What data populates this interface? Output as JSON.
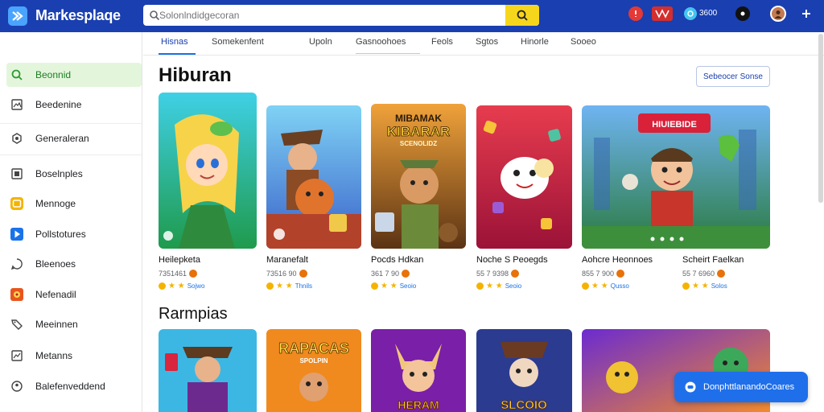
{
  "header": {
    "brand": "Markesplaqe",
    "search_placeholder": "Solonlndidgecoran"
  },
  "topbar_icons": {
    "coin_value": "3600",
    "items": [
      "notification-icon",
      "brand-badge-icon",
      "coin-icon",
      "settings-icon",
      "avatar",
      "more-icon"
    ]
  },
  "sidebar": {
    "items": [
      {
        "label": "Beonnid",
        "icon": "search-icon",
        "active": true
      },
      {
        "label": "Beedenine",
        "icon": "image-icon"
      },
      {
        "label": "Generaleran",
        "icon": "gear-icon"
      },
      {
        "label": "Boselnples",
        "icon": "image-icon"
      },
      {
        "label": "Mennoge",
        "icon": "message-icon"
      },
      {
        "label": "Pollstotures",
        "icon": "play-icon"
      },
      {
        "label": "Bleenoes",
        "icon": "chat-icon"
      },
      {
        "label": "Nefenadil",
        "icon": "game-icon"
      },
      {
        "label": "Meeinnen",
        "icon": "tag-icon"
      },
      {
        "label": "Metanns",
        "icon": "image-icon"
      },
      {
        "label": "Balefenveddend",
        "icon": "profile-icon"
      }
    ]
  },
  "tabs": [
    {
      "label": "Hisnas",
      "active": true
    },
    {
      "label": "Somekenfent"
    },
    {
      "label": "Upoln"
    },
    {
      "label": "Gasnoohoes"
    },
    {
      "label": "Feols"
    },
    {
      "label": "Sgtos"
    },
    {
      "label": "Hinorle"
    },
    {
      "label": "Sooeo"
    }
  ],
  "section1": {
    "title": "Hiburan",
    "see_all": "Sebeocer Sonse",
    "cards": [
      {
        "title": "Heilepketa",
        "meta": "7351461",
        "rating": "Sojwo"
      },
      {
        "title": "Maranefalt",
        "meta": "73516 90",
        "rating": "Thnils"
      },
      {
        "title": "Pocds Hdkan",
        "meta": "361 7 90",
        "rating": "Seoio"
      },
      {
        "title": "Noche S Peoegds",
        "meta": "55 7 9398",
        "rating": "Seoio"
      },
      {
        "title": "Aohcre Heonnoes",
        "meta": "855 7 900",
        "rating": "Qusso"
      },
      {
        "title": "Scheirt Faelkan",
        "meta": "55 7 6960",
        "rating": "Solos"
      }
    ],
    "poster_texts": [
      "MIBAMAK",
      "KIBARAR",
      "SCENOLIDZ"
    ],
    "banner_text": "HIUIEBIDE"
  },
  "section2": {
    "title": "Rarmpias",
    "poster_texts": [
      "RAPACAS",
      "SPOLPIN",
      "HERAM",
      "SLCOIO"
    ]
  },
  "float_button": {
    "label": "DonphttlanandoCoares"
  },
  "colors": {
    "topbar": "#1a3fb0",
    "search_button": "#f6d61c",
    "active_sidebar": "#e3f6dc",
    "accent_blue": "#1f6feb",
    "star": "#f5b301"
  }
}
